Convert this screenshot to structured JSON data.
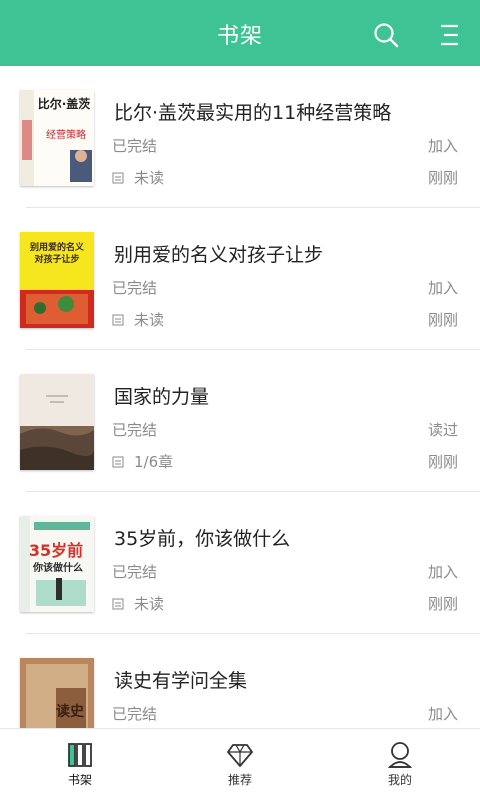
{
  "header": {
    "title": "书架",
    "search_icon": "search-icon",
    "menu_icon": "menu-icon",
    "background": "#3ec395"
  },
  "books": [
    {
      "title": "比尔·盖茨最实用的11种经营策略",
      "status": "已完结",
      "progress": "未读",
      "action": "加入",
      "time": "刚刚",
      "cover": {
        "big_text": "比尔·盖茨",
        "sub_text": "经营策略",
        "colors": [
          "#fdfcf7",
          "#c9262c",
          "#2a2a2a"
        ]
      }
    },
    {
      "title": "别用爱的名义对孩子让步",
      "status": "已完结",
      "progress": "未读",
      "action": "加入",
      "time": "刚刚",
      "cover": {
        "big_text": "别用爱的名义对孩子让步",
        "colors": [
          "#f5e61d",
          "#d02a1f",
          "#3a2a1a"
        ]
      }
    },
    {
      "title": "国家的力量",
      "status": "已完结",
      "progress": "1/6章",
      "action": "读过",
      "time": "刚刚",
      "cover": {
        "colors": [
          "#efe9e2",
          "#7d6550",
          "#3d3128"
        ]
      }
    },
    {
      "title": "35岁前，你该做什么",
      "status": "已完结",
      "progress": "未读",
      "action": "加入",
      "time": "刚刚",
      "cover": {
        "big_text": "35岁前",
        "sub_text": "你该做什么",
        "colors": [
          "#f7f7f4",
          "#d63126",
          "#5fb79a"
        ]
      }
    },
    {
      "title": "读史有学问全集",
      "status": "已完结",
      "progress": "",
      "action": "加入",
      "time": "",
      "cover": {
        "big_text": "读史",
        "colors": [
          "#b9865d",
          "#7a4a2c",
          "#e3c9a4"
        ]
      }
    }
  ],
  "tabs": [
    {
      "label": "书架",
      "icon": "bookshelf-icon",
      "active": true
    },
    {
      "label": "推荐",
      "icon": "diamond-icon",
      "active": false
    },
    {
      "label": "我的",
      "icon": "user-icon",
      "active": false
    }
  ]
}
